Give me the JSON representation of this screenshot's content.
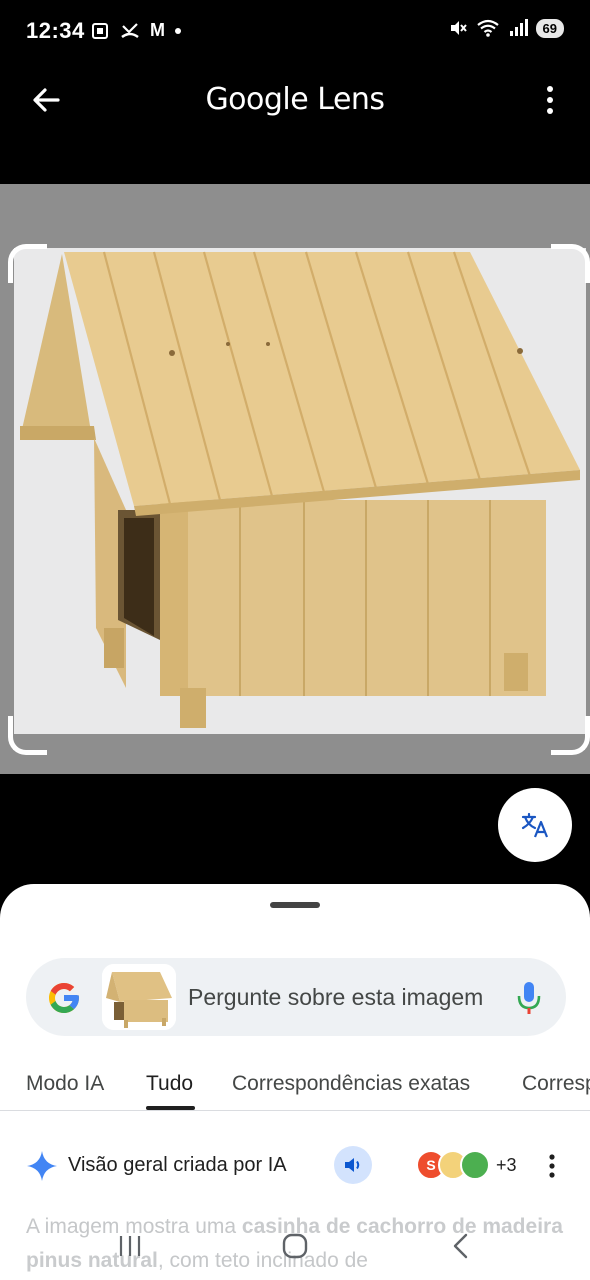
{
  "status_bar": {
    "time": "12:34",
    "left_icons": [
      "screenshot-icon",
      "missed-call-icon",
      "gmail-icon",
      "dot-icon"
    ],
    "gmail_letter": "M",
    "right_icons": [
      "mute-icon",
      "wifi-icon",
      "signal-icon"
    ],
    "battery": "69"
  },
  "app_bar": {
    "title": "Google Lens",
    "back_icon": "arrow-back-icon",
    "more_icon": "more-vert-icon"
  },
  "translate_icon": "translate-icon",
  "search": {
    "placeholder": "Pergunte sobre esta imagem",
    "mic_icon": "mic-icon"
  },
  "tabs": [
    {
      "label": "Modo IA"
    },
    {
      "label": "Tudo",
      "active": true
    },
    {
      "label": "Correspondências exatas"
    },
    {
      "label": "Correspondências visuais"
    }
  ],
  "ai_overview": {
    "label": "Visão geral criada por IA",
    "sources_more": "+3",
    "text_part1": "A imagem mostra uma ",
    "text_bold1": "casinha de cachorro de madeira pinus natural",
    "text_part2": ", com teto inclinado de"
  },
  "nav_bar": {
    "recents_icon": "recents-icon",
    "home_icon": "home-icon",
    "back_icon": "nav-back-icon"
  },
  "colors": {
    "google_blue": "#4285F4",
    "google_red": "#EA4335",
    "google_yellow": "#FBBC05",
    "google_green": "#34A853",
    "speaker_bg": "#d3e3fd"
  }
}
